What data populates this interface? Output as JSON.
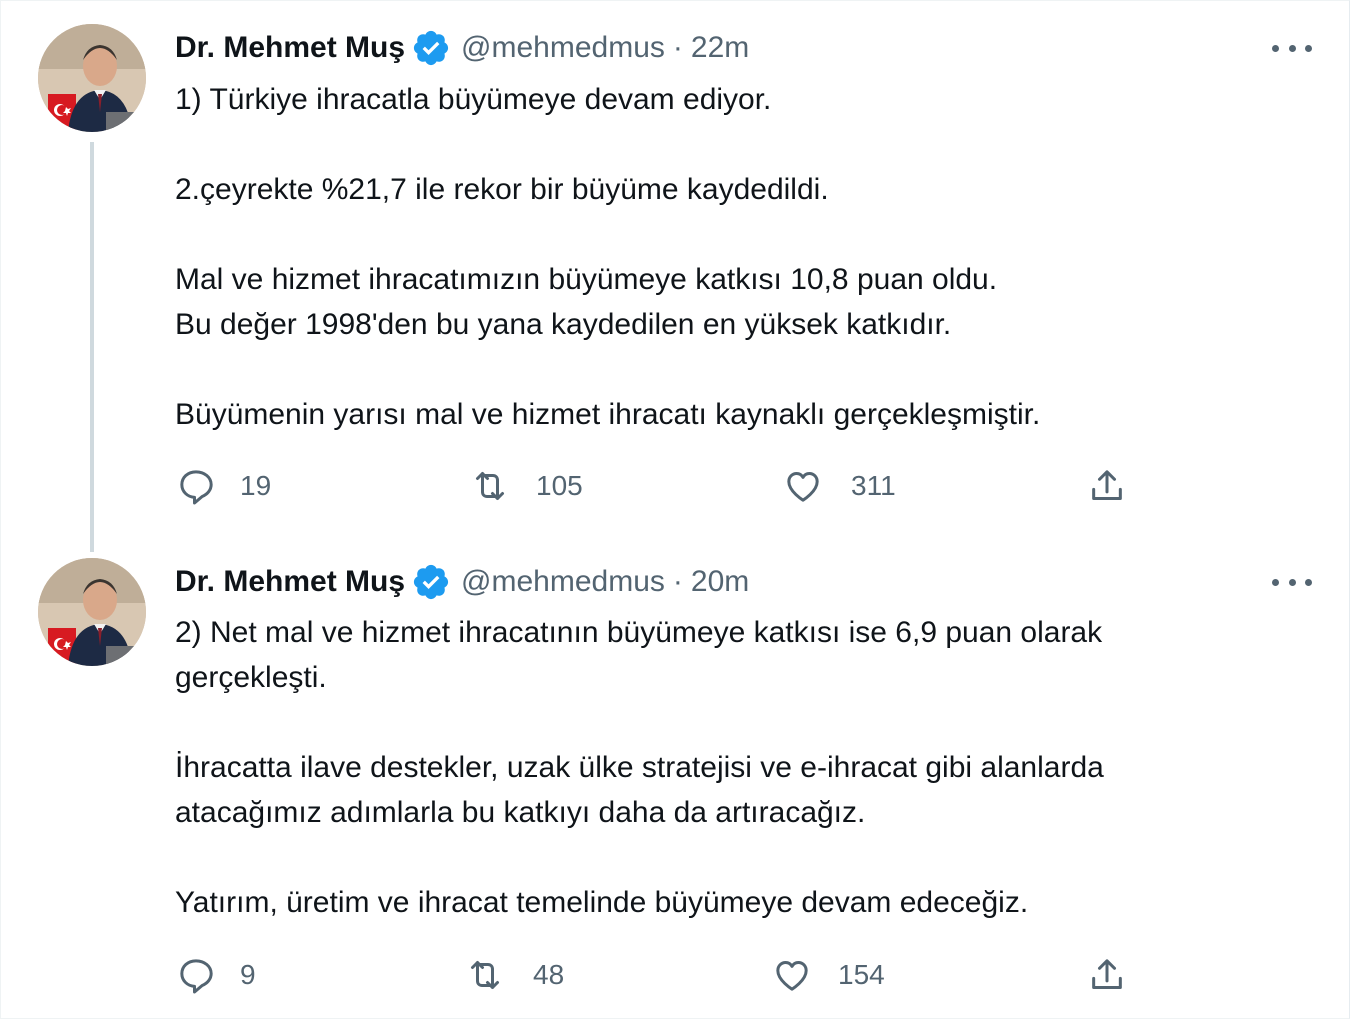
{
  "colors": {
    "verified": "#1d9bf0",
    "secondary_text": "#536471",
    "primary_text": "#0f1419",
    "thread_line": "#cfd9de"
  },
  "tweets": [
    {
      "author_name": "Dr. Mehmet Muş",
      "handle": "@mehmedmus",
      "separator": "·",
      "time": "22m",
      "lines": [
        "1) Türkiye ihracatla büyümeye devam ediyor.",
        "",
        "2.çeyrekte %21,7 ile rekor bir büyüme kaydedildi.",
        "",
        "Mal ve hizmet ihracatımızın büyümeye katkısı 10,8 puan oldu.",
        "Bu değer 1998'den bu yana kaydedilen en yüksek katkıdır.",
        "",
        "Büyümenin yarısı mal ve hizmet ihracatı kaynaklı gerçekleşmiştir."
      ],
      "replies": "19",
      "retweets": "105",
      "likes": "311"
    },
    {
      "author_name": "Dr. Mehmet Muş",
      "handle": "@mehmedmus",
      "separator": "·",
      "time": "20m",
      "lines": [
        "2) Net mal ve hizmet ihracatının büyümeye katkısı ise 6,9 puan olarak",
        "gerçekleşti.",
        "",
        "İhracatta ilave destekler, uzak ülke stratejisi ve e-ihracat gibi alanlarda",
        "atacağımız adımlarla bu katkıyı daha da artıracağız.",
        "",
        "Yatırım, üretim ve ihracat temelinde büyümeye devam edeceğiz."
      ],
      "replies": "9",
      "retweets": "48",
      "likes": "154"
    }
  ],
  "icons": {
    "reply": "reply-icon",
    "retweet": "retweet-icon",
    "like": "heart-icon",
    "share": "share-icon",
    "more": "more-icon",
    "verified": "verified-badge-icon"
  }
}
